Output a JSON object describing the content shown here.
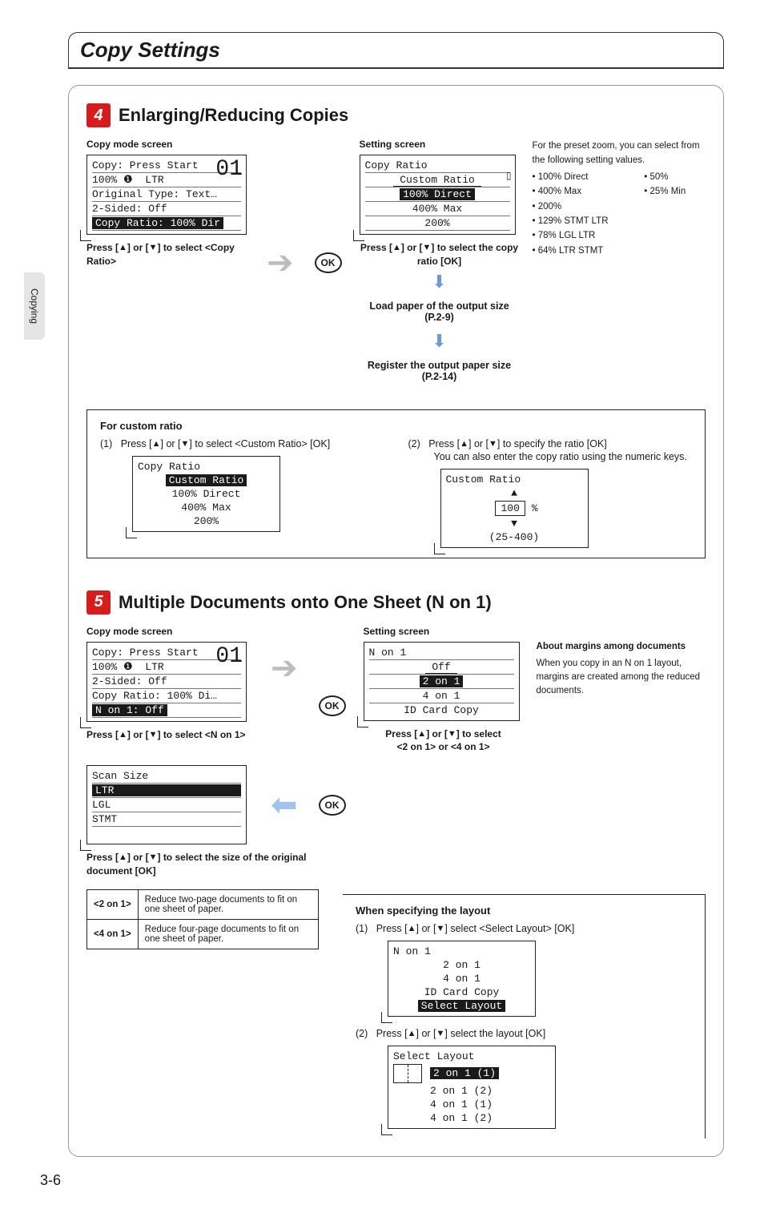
{
  "sideTab": "Copying",
  "pageTitle": "Copy Settings",
  "pageNumber": "3-6",
  "sec4": {
    "num": "4",
    "title": "Enarging/Reducing Copies",
    "titleFixed": "Enlarging/Reducing Copies",
    "copyModeLabel": "Copy mode screen",
    "settingLabel": "Setting screen",
    "lcd1": {
      "l1": "Copy: Press Start",
      "l2a": "100%",
      "l2b": "LTR",
      "l3": "Original Type: Text…",
      "l4": "2-Sided: Off",
      "l5": "Copy Ratio: 100% Dir",
      "big": "01"
    },
    "cap1a": "Press [",
    "cap1b": "] or [",
    "cap1c": "] to select <Copy Ratio>",
    "ok": "OK",
    "lcd2": {
      "title": "Copy Ratio",
      "i1": "Custom Ratio",
      "i2": "100% Direct",
      "i3": "400% Max",
      "i4": "200%"
    },
    "cap2a": "Press [",
    "cap2b": "] or [",
    "cap2c": "] to select the copy ratio  [OK]",
    "flow1": "Load paper of the output size (P.2-9)",
    "flow2": "Register the output paper size (P.2-14)",
    "preset": {
      "intro": "For the preset zoom, you can select from the following setting values.",
      "items": [
        "100% Direct",
        "50%",
        "400% Max",
        "25% Min",
        "200%",
        "",
        "129% STMT  LTR",
        "",
        "78% LGL  LTR",
        "",
        "64% LTR  STMT",
        ""
      ]
    },
    "custom": {
      "title": "For custom ratio",
      "s1n": "(1)",
      "s1a": "Press [",
      "s1b": "] or [",
      "s1c": "] to select <Custom Ratio>  [OK]",
      "lcdA": {
        "title": "Copy Ratio",
        "i1": "Custom Ratio",
        "i2": "100% Direct",
        "i3": "400% Max",
        "i4": "200%"
      },
      "s2n": "(2)",
      "s2a": "Press [",
      "s2b": "] or [",
      "s2c": "] to specify the ratio  [OK]",
      "s2d": "You can also enter the copy ratio using the numeric keys.",
      "lcdB": {
        "title": "Custom Ratio",
        "val": "100",
        "pct": "%",
        "range": "(25-400)"
      }
    }
  },
  "sec5": {
    "num": "5",
    "title": "Multiple Documents onto One Sheet (N on 1)",
    "copyModeLabel": "Copy mode screen",
    "settingLabel": "Setting screen",
    "lcd1": {
      "l1": "Copy: Press Start",
      "l2a": "100%",
      "l2b": "LTR",
      "l3": "2-Sided: Off",
      "l4": "Copy Ratio: 100% Di…",
      "l5": "N on 1: Off",
      "big": "01"
    },
    "cap1a": "Press [",
    "cap1b": "] or [",
    "cap1c": "] to select <N on 1>",
    "ok": "OK",
    "lcd2": {
      "title": "N on 1",
      "i1": "Off",
      "i2": "2 on 1",
      "i3": "4 on 1",
      "i4": "ID Card Copy"
    },
    "cap2a": "Press [",
    "cap2b": "] or [",
    "cap2c": "] to select",
    "cap2d": "<2 on 1> or <4 on 1>",
    "lcd3": {
      "title": "Scan Size",
      "i1": "LTR",
      "i2": "LGL",
      "i3": "STMT"
    },
    "cap3a": "Press [",
    "cap3b": "] or [",
    "cap3c": "] to select the size of the original document  [OK]",
    "table": {
      "r1h": "<2 on 1>",
      "r1d": "Reduce two-page documents to fit on one sheet of paper.",
      "r2h": "<4 on 1>",
      "r2d": "Reduce four-page documents to fit on one sheet of paper."
    },
    "info": {
      "hd": "About margins among documents",
      "body": "When you copy in an N on 1 layout, margins are created among the reduced documents."
    },
    "layout": {
      "title": "When specifying the layout",
      "s1n": "(1)",
      "s1a": "Press [",
      "s1b": "] or [",
      "s1c": "] select <Select Layout>  [OK]",
      "lcdA": {
        "title": "N on 1",
        "i1": "2 on 1",
        "i2": "4 on 1",
        "i3": "ID Card Copy",
        "i4": "Select Layout"
      },
      "s2n": "(2)",
      "s2a": "Press [",
      "s2b": "] or [",
      "s2c": "] select the layout  [OK]",
      "lcdB": {
        "title": "Select Layout",
        "i1": "2 on 1 (1)",
        "i2": "2 on 1 (2)",
        "i3": "4 on 1 (1)",
        "i4": "4 on 1 (2)"
      }
    }
  }
}
